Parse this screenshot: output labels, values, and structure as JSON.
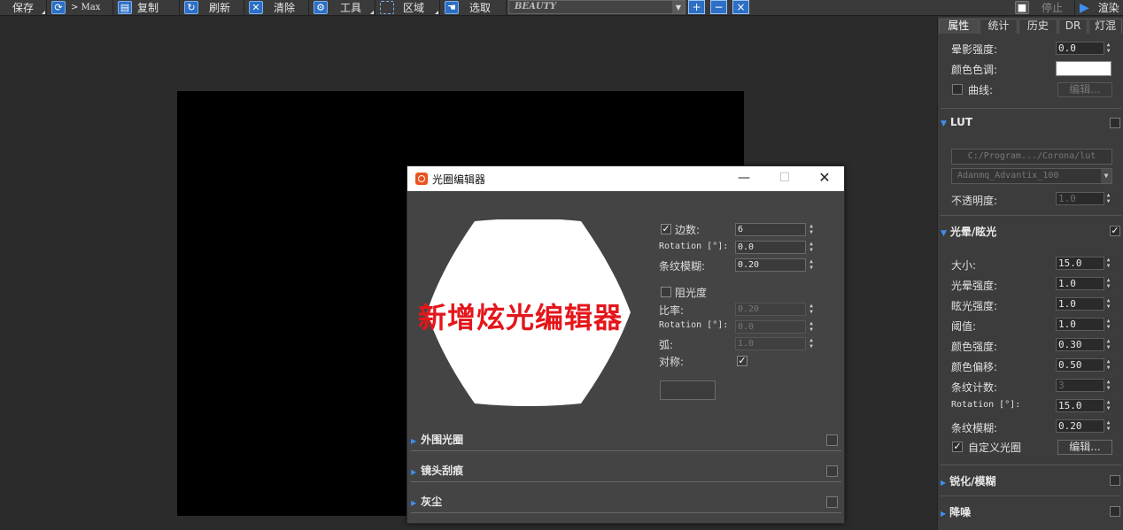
{
  "toolbar": {
    "save": "保存",
    "max": "> Max",
    "copy": "复制",
    "refresh": "刷新",
    "clear": "清除",
    "tools": "工具",
    "region": "区域",
    "pick": "选取",
    "channel": "BEAUTY",
    "stop": "停止",
    "render": "渲染"
  },
  "panel": {
    "tabs": [
      "属性",
      "统计",
      "历史",
      "DR",
      "灯混"
    ],
    "vignette_strength_label": "晕影强度:",
    "vignette_strength": "0.0",
    "tint_label": "颜色色调:",
    "curve_label": "曲线:",
    "curve_edit": "编辑...",
    "lut_header": "LUT",
    "lut_path": "C:/Program.../Corona/lut",
    "lut_file": "Adanmq_Advantix_100",
    "opacity_label": "不透明度:",
    "opacity": "1.0",
    "bloom_header": "光晕/眩光",
    "size_label": "大小:",
    "size": "15.0",
    "bloom_strength_label": "光晕强度:",
    "bloom_strength": "1.0",
    "glare_strength_label": "眩光强度:",
    "glare_strength": "1.0",
    "threshold_label": "阈值:",
    "threshold": "1.0",
    "color_strength_label": "颜色强度:",
    "color_strength": "0.30",
    "color_shift_label": "颜色偏移:",
    "color_shift": "0.50",
    "streak_count_label": "条纹计数:",
    "streak_count": "3",
    "rotation_label": "Rotation [°]:",
    "rotation": "15.0",
    "streak_blur_label": "条纹模糊:",
    "streak_blur": "0.20",
    "custom_aperture_label": "自定义光圈",
    "custom_edit": "编辑...",
    "sharpen_header": "锐化/模糊",
    "denoise_header": "降噪",
    "tint_color": "#ffffff"
  },
  "dialog": {
    "title": "光圈编辑器",
    "blades_label": "边数:",
    "blades": "6",
    "rotation_label": "Rotation [°]:",
    "rotation": "0.0",
    "streak_blur_label": "条纹模糊:",
    "streak_blur": "0.20",
    "obstacle_label": "阻光度",
    "ratio_label": "比率:",
    "ratio": "0.20",
    "rotation2_label": "Rotation [°]:",
    "rotation2": "0.0",
    "arc_label": "弧:",
    "arc": "1.0",
    "symmetry_label": "对称:",
    "outer_rim_label": "外围光圈",
    "scratches_label": "镜头刮痕",
    "dust_label": "灰尘"
  },
  "overlay_title": "新增炫光编辑器",
  "colors": {
    "accent_blue": "#2d6fc4",
    "overlay_red": "#e4161b"
  }
}
